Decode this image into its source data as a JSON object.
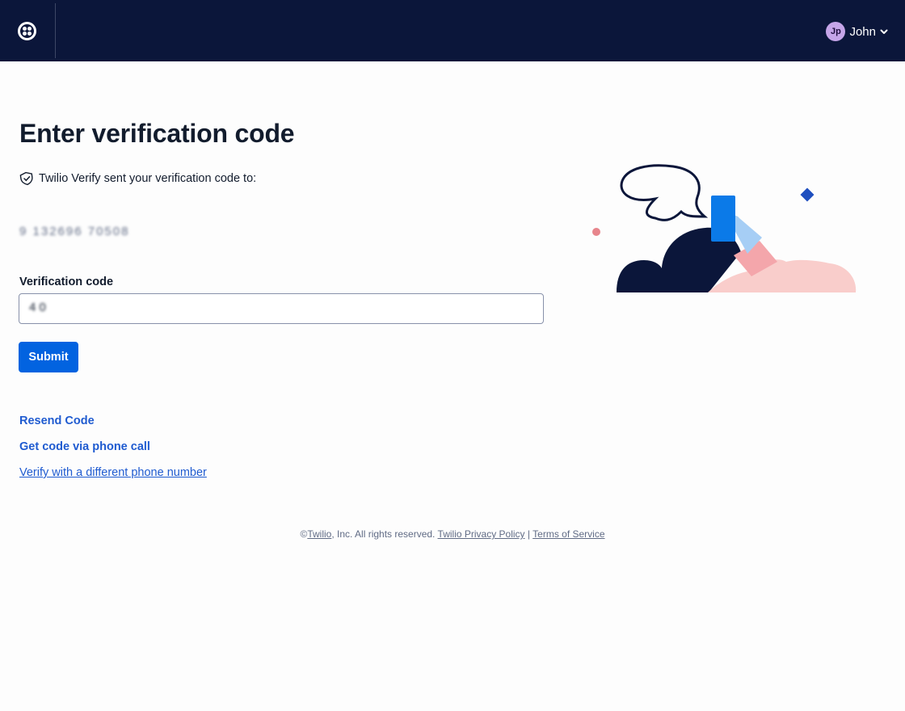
{
  "header": {
    "logo_icon": "twilio-logo-icon",
    "user": {
      "initials": "Jp",
      "name": "John",
      "dropdown_icon": "chevron-down-icon"
    }
  },
  "main": {
    "title": "Enter verification code",
    "sent_message": "Twilio Verify sent your verification code to:",
    "sent_icon": "shield-check-icon",
    "phone_number": "9 132696 70508",
    "code_label": "Verification code",
    "code_value": "4 0",
    "submit_label": "Submit"
  },
  "links": {
    "resend": "Resend Code",
    "phone_call": "Get code via phone call",
    "different_number": "Verify with a different phone number"
  },
  "footer": {
    "copyright_prefix": "©",
    "company_link": "Twilio",
    "rights": ", Inc. All rights reserved.",
    "privacy_link": "Twilio Privacy Policy",
    "separator": "|",
    "terms_link": "Terms of Service"
  },
  "colors": {
    "topbar": "#0b163a",
    "primary": "#0263e0",
    "link": "#1f5bd0",
    "avatar": "#c5a5e8"
  }
}
